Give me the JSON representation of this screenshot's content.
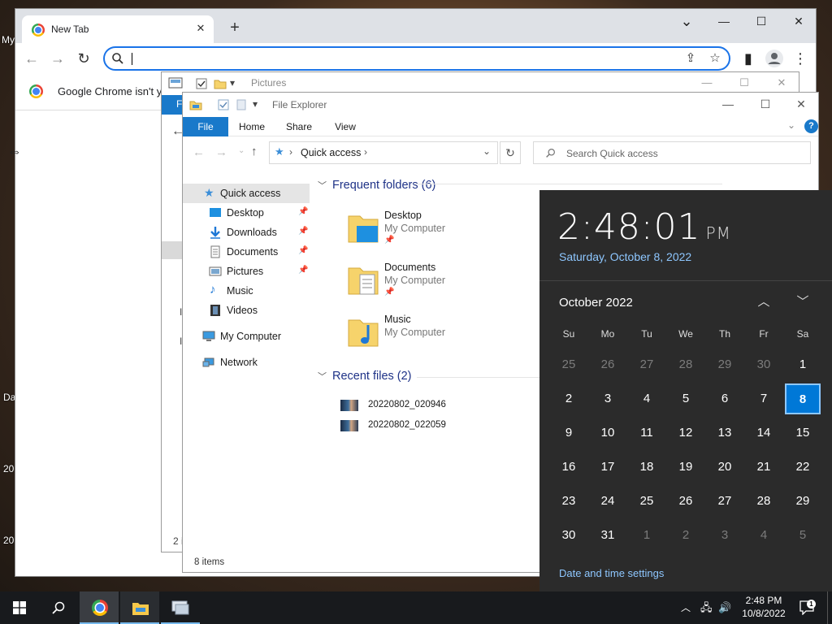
{
  "desktop": {
    "fragments": [
      "My",
      "Da",
      "20",
      "20"
    ]
  },
  "chrome": {
    "tab_title": "New Tab",
    "close_tab": "✕",
    "new_tab": "+",
    "window_controls": {
      "dropdown": "⌄",
      "minimize": "—",
      "maximize": "☐",
      "close": "✕"
    },
    "omnibox_value": "",
    "infobar_text": "Google Chrome isn't y"
  },
  "pictures_window": {
    "title": "Pictures",
    "fragments": [
      "F",
      "←",
      "I",
      "I",
      "2 i"
    ]
  },
  "explorer": {
    "title": "File Explorer",
    "ribbon_tabs": [
      "File",
      "Home",
      "Share",
      "View"
    ],
    "breadcrumb": "Quick access",
    "search_placeholder": "Search Quick access",
    "nav": {
      "quick_access": "Quick access",
      "items": [
        "Desktop",
        "Downloads",
        "Documents",
        "Pictures",
        "Music",
        "Videos"
      ],
      "my_computer": "My Computer",
      "network": "Network"
    },
    "frequent_header": "Frequent folders (6)",
    "folders": [
      {
        "name": "Desktop",
        "location": "My Computer",
        "pinned": true
      },
      {
        "name": "Documents",
        "location": "My Computer",
        "pinned": true
      },
      {
        "name": "Music",
        "location": "My Computer",
        "pinned": false
      }
    ],
    "recent_header": "Recent files (2)",
    "recent_files": [
      "20220802_020946",
      "20220802_022059"
    ],
    "status": "8 items"
  },
  "clock_flyout": {
    "time": "2:48:01",
    "ampm": "PM",
    "long_date": "Saturday, October 8, 2022",
    "month_label": "October 2022",
    "weekdays": [
      "Su",
      "Mo",
      "Tu",
      "We",
      "Th",
      "Fr",
      "Sa"
    ],
    "weeks": [
      [
        "25",
        "26",
        "27",
        "28",
        "29",
        "30",
        "1"
      ],
      [
        "2",
        "3",
        "4",
        "5",
        "6",
        "7",
        "8"
      ],
      [
        "9",
        "10",
        "11",
        "12",
        "13",
        "14",
        "15"
      ],
      [
        "16",
        "17",
        "18",
        "19",
        "20",
        "21",
        "22"
      ],
      [
        "23",
        "24",
        "25",
        "26",
        "27",
        "28",
        "29"
      ],
      [
        "30",
        "31",
        "1",
        "2",
        "3",
        "4",
        "5"
      ]
    ],
    "selected_day": "8",
    "settings_link": "Date and time settings"
  },
  "taskbar": {
    "time": "2:48 PM",
    "date": "10/8/2022",
    "notifications": "1"
  },
  "colors": {
    "accent": "#0078d7",
    "explorer_file_tab": "#1979ca",
    "flyout_bg": "#2b2b2b",
    "link_blue": "#8ec7ff"
  }
}
